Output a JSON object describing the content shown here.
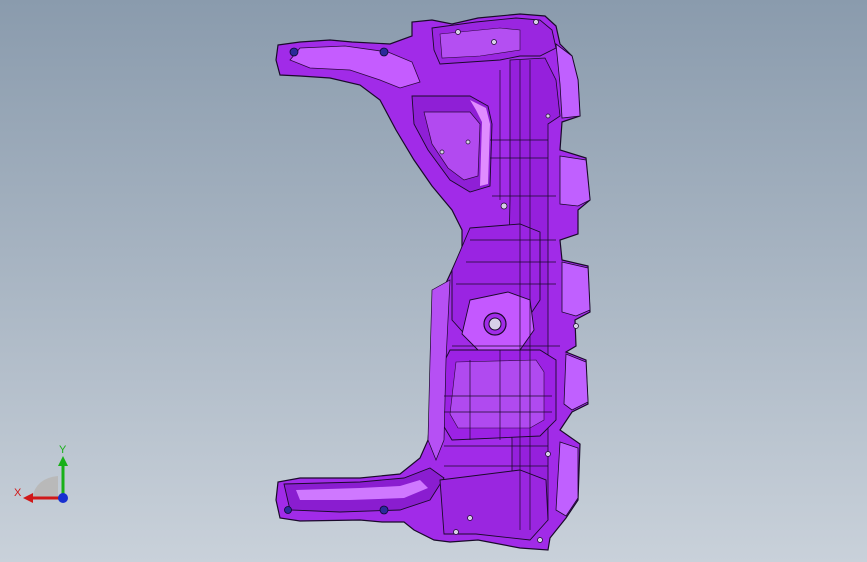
{
  "viewport": {
    "background_top": "#8a9bad",
    "background_bottom": "#c9d1da"
  },
  "model": {
    "part_color": "#a12be8",
    "part_dark": "#6a10a8",
    "part_light": "#d070ff",
    "edge_color": "#1a0a2a",
    "hole_color": "#2a2a9a"
  },
  "triad": {
    "x_label": "X",
    "y_label": "Y",
    "x_color": "#d01818",
    "y_color": "#18b018",
    "z_color": "#1830d0"
  }
}
